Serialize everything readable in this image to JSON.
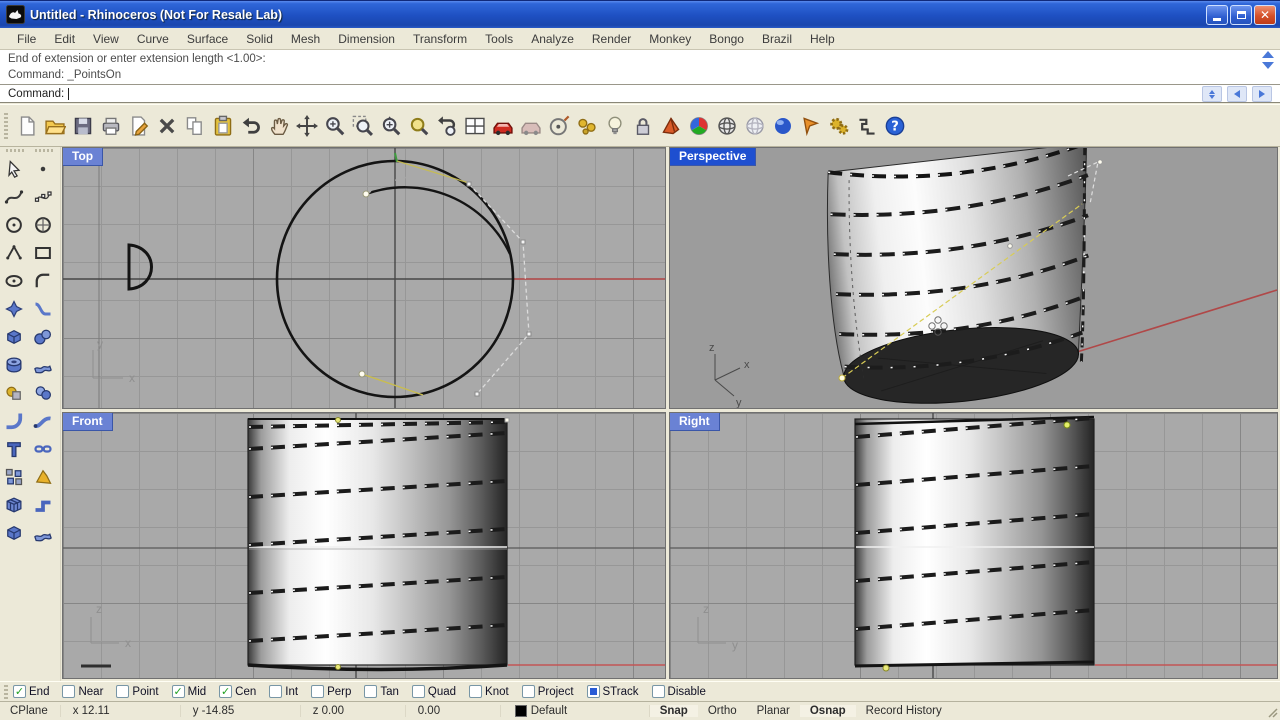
{
  "window": {
    "title": "Untitled - Rhinoceros (Not For Resale Lab)",
    "buttons": [
      "minimize",
      "maximize",
      "close"
    ]
  },
  "menu": {
    "items": [
      "File",
      "Edit",
      "View",
      "Curve",
      "Surface",
      "Solid",
      "Mesh",
      "Dimension",
      "Transform",
      "Tools",
      "Analyze",
      "Render",
      "Monkey",
      "Bongo",
      "Brazil",
      "Help"
    ]
  },
  "command": {
    "history": [
      "End of extension or enter extension length <1.00>:",
      "Command: _PointsOn"
    ],
    "prompt": "Command:",
    "input_value": ""
  },
  "toolbar": {
    "icons": [
      "new-file",
      "open-folder",
      "save",
      "print",
      "edit-page",
      "delete",
      "copy",
      "paste",
      "undo",
      "pan-hand",
      "rotate-view",
      "zoom",
      "zoom-window",
      "zoom-dynamic",
      "zoom-extents",
      "zoom-back",
      "viewport-grid",
      "render-car",
      "render-preview",
      "orient-cplane",
      "gumball-balls",
      "lamp",
      "lock",
      "shade-mode",
      "color-wheel",
      "wireframe-view",
      "ghosted-view",
      "rendered-view",
      "notify-flag",
      "settings-gears",
      "history-record",
      "help"
    ]
  },
  "side_toolbar": {
    "icons": [
      "select",
      "point",
      "curve",
      "point-edit",
      "circle-tool",
      "circle-3pt",
      "curve-interp",
      "rectangle-tool",
      "ellipse-tool",
      "corner-arc",
      "surface-patch",
      "surface-blend",
      "solid-box",
      "solid-spheres",
      "solid-tube",
      "mesh-strip",
      "boolean-union",
      "boolean-diff",
      "fillet-edge",
      "pipe-tool",
      "text-tool",
      "chain-link",
      "block-squares",
      "fin-tool",
      "mesh-box",
      "elbow",
      "solid-box",
      "mesh-strip"
    ]
  },
  "viewports": [
    {
      "label": "Top",
      "active": false
    },
    {
      "label": "Perspective",
      "active": true
    },
    {
      "label": "Front",
      "active": false
    },
    {
      "label": "Right",
      "active": false
    }
  ],
  "osnap": {
    "items": [
      {
        "label": "End",
        "state": "checked"
      },
      {
        "label": "Near",
        "state": "unchecked"
      },
      {
        "label": "Point",
        "state": "unchecked"
      },
      {
        "label": "Mid",
        "state": "checked"
      },
      {
        "label": "Cen",
        "state": "checked"
      },
      {
        "label": "Int",
        "state": "unchecked"
      },
      {
        "label": "Perp",
        "state": "unchecked"
      },
      {
        "label": "Tan",
        "state": "unchecked"
      },
      {
        "label": "Quad",
        "state": "unchecked"
      },
      {
        "label": "Knot",
        "state": "unchecked"
      },
      {
        "label": "Project",
        "state": "unchecked"
      },
      {
        "label": "STrack",
        "state": "filled"
      },
      {
        "label": "Disable",
        "state": "unchecked"
      }
    ]
  },
  "status": {
    "cplane_label": "CPlane",
    "coords": {
      "x": "x 12.11",
      "y": "y -14.85",
      "z": "z 0.00",
      "delta": "0.00"
    },
    "layer": {
      "name": "Default",
      "swatch_color": "#000000"
    },
    "panes": [
      {
        "label": "Snap",
        "active": true
      },
      {
        "label": "Ortho",
        "active": false
      },
      {
        "label": "Planar",
        "active": false
      },
      {
        "label": "Osnap",
        "active": true
      },
      {
        "label": "Record History",
        "active": false
      }
    ]
  },
  "colors": {
    "titlebar_blue": "#1e50c2",
    "chrome_beige": "#ece9d8",
    "viewport_label_active": "#1e4fd0",
    "viewport_label_inactive": "#6a82d4",
    "viewport_bg": "#a9a9a9",
    "grid_line": "#979797",
    "axis_red": "#c25555",
    "highlight_yellow": "#c9bd4e",
    "check_green": "#21a121",
    "strack_blue": "#2a5cd6"
  }
}
